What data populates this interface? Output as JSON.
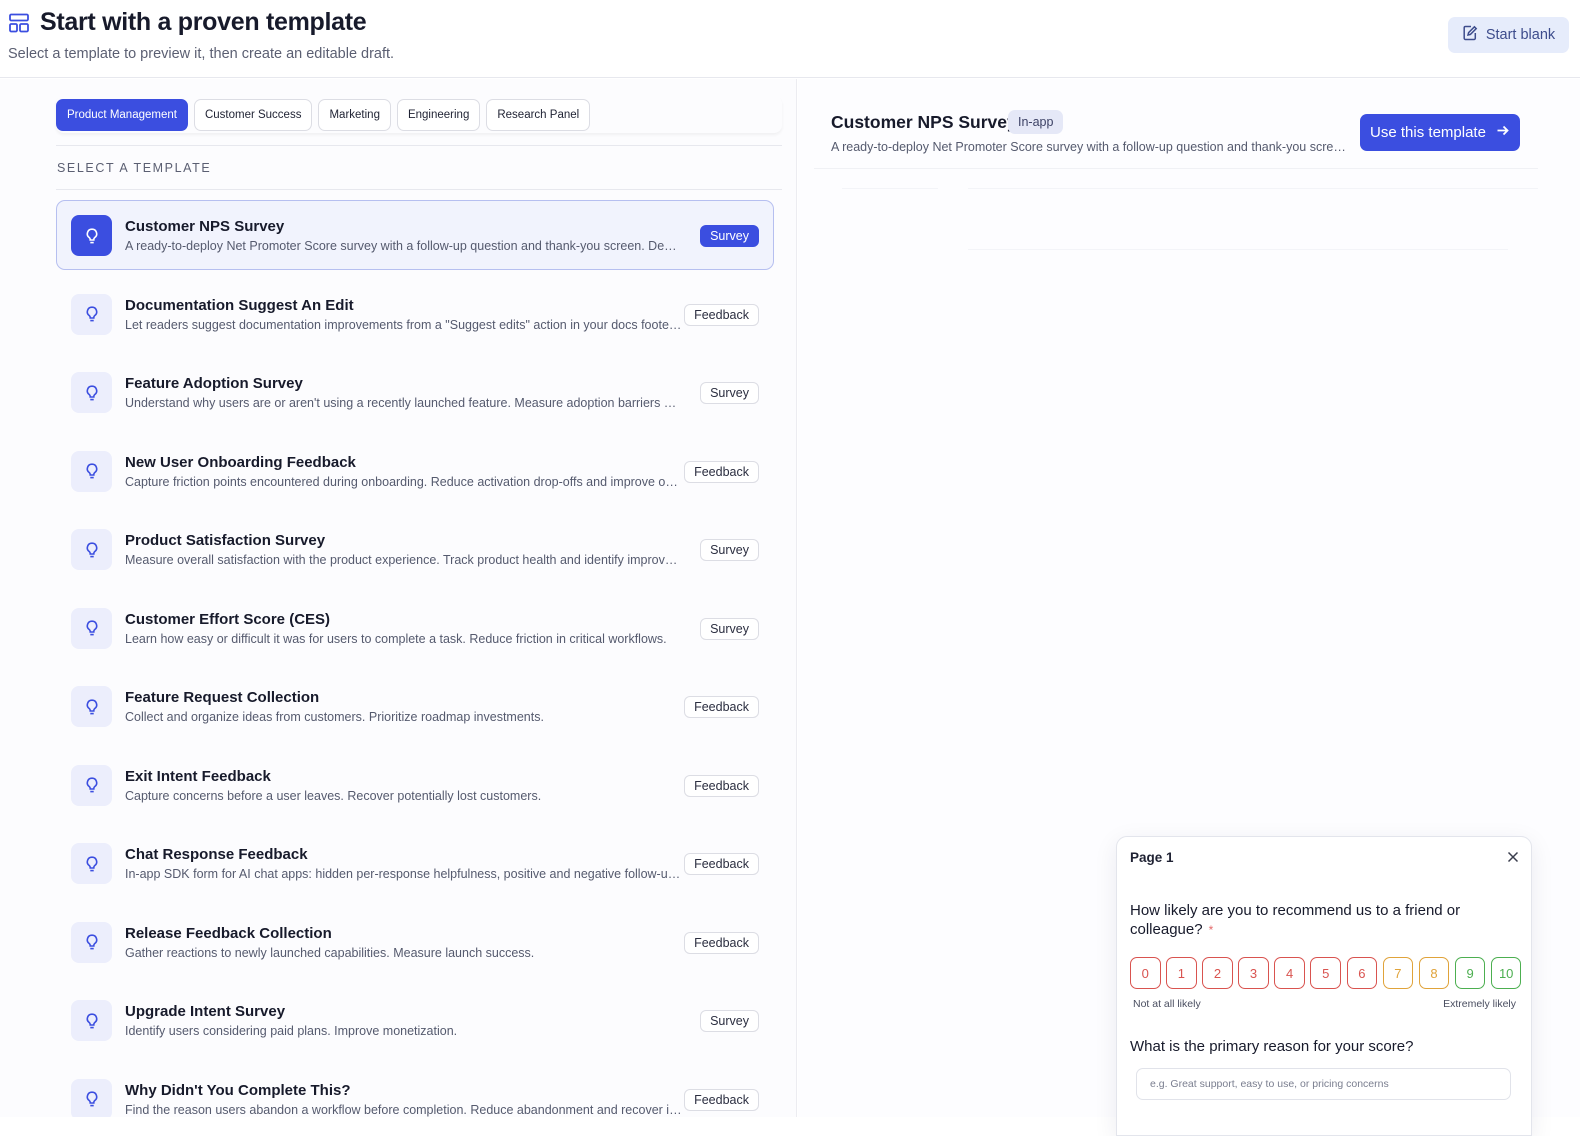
{
  "header": {
    "title": "Start with a proven template",
    "subtitle": "Select a template to preview it, then create an editable draft.",
    "start_blank_label": "Start blank"
  },
  "tabs": [
    {
      "label": "Product Management",
      "active": true
    },
    {
      "label": "Customer Success",
      "active": false
    },
    {
      "label": "Marketing",
      "active": false
    },
    {
      "label": "Engineering",
      "active": false
    },
    {
      "label": "Research Panel",
      "active": false
    }
  ],
  "section_label": "SELECT A TEMPLATE",
  "templates": [
    {
      "name": "Customer NPS Survey",
      "description": "A ready-to-deploy Net Promoter Score survey with a follow-up question and thank-you screen. Deploy in...",
      "badge": "Survey",
      "selected": true
    },
    {
      "name": "Documentation Suggest An Edit",
      "description": "Let readers suggest documentation improvements from a \"Suggest edits\" action in your docs footer. C...",
      "badge": "Feedback"
    },
    {
      "name": "Feature Adoption Survey",
      "description": "Understand why users are or aren't using a recently launched feature. Measure adoption barriers and prio...",
      "badge": "Survey"
    },
    {
      "name": "New User Onboarding Feedback",
      "description": "Capture friction points encountered during onboarding. Reduce activation drop-offs and improve onbo...",
      "badge": "Feedback"
    },
    {
      "name": "Product Satisfaction Survey",
      "description": "Measure overall satisfaction with the product experience. Track product health and identify improvement ...",
      "badge": "Survey"
    },
    {
      "name": "Customer Effort Score (CES)",
      "description": "Learn how easy or difficult it was for users to complete a task. Reduce friction in critical workflows.",
      "badge": "Survey"
    },
    {
      "name": "Feature Request Collection",
      "description": "Collect and organize ideas from customers. Prioritize roadmap investments.",
      "badge": "Feedback"
    },
    {
      "name": "Exit Intent Feedback",
      "description": "Capture concerns before a user leaves. Recover potentially lost customers.",
      "badge": "Feedback"
    },
    {
      "name": "Chat Response Feedback",
      "description": "In-app SDK form for AI chat apps: hidden per-response helpfulness, positive and negative follow-ups, ...",
      "badge": "Feedback"
    },
    {
      "name": "Release Feedback Collection",
      "description": "Gather reactions to newly launched capabilities. Measure launch success.",
      "badge": "Feedback"
    },
    {
      "name": "Upgrade Intent Survey",
      "description": "Identify users considering paid plans. Improve monetization.",
      "badge": "Survey"
    },
    {
      "name": "Why Didn't You Complete This?",
      "description": "Find the reason users abandon a workflow before completion. Reduce abandonment and recover inco...",
      "badge": "Feedback"
    }
  ],
  "preview": {
    "title": "Customer NPS Survey",
    "channel_badge": "In-app",
    "description": "A ready-to-deploy Net Promoter Score survey with a follow-up question and thank-you screen. D...",
    "use_button_label": "Use this template"
  },
  "widget": {
    "page_label": "Page 1",
    "question1": "How likely are you to recommend us to a friend or colleague?",
    "required_mark": "*",
    "scale": [
      {
        "label": "0",
        "color": "#d9534f"
      },
      {
        "label": "1",
        "color": "#d9534f"
      },
      {
        "label": "2",
        "color": "#d9534f"
      },
      {
        "label": "3",
        "color": "#d9534f"
      },
      {
        "label": "4",
        "color": "#d9534f"
      },
      {
        "label": "5",
        "color": "#d9534f"
      },
      {
        "label": "6",
        "color": "#d9534f"
      },
      {
        "label": "7",
        "color": "#e0a33a"
      },
      {
        "label": "8",
        "color": "#e0a33a"
      },
      {
        "label": "9",
        "color": "#4caf50"
      },
      {
        "label": "10",
        "color": "#4caf50"
      }
    ],
    "low_label": "Not at all likely",
    "high_label": "Extremely likely",
    "question2": "What is the primary reason for your score?",
    "input_placeholder": "e.g. Great support, easy to use, or pricing concerns"
  },
  "colors": {
    "accent": "#3b4ee0",
    "accent_light": "#eceefc"
  }
}
